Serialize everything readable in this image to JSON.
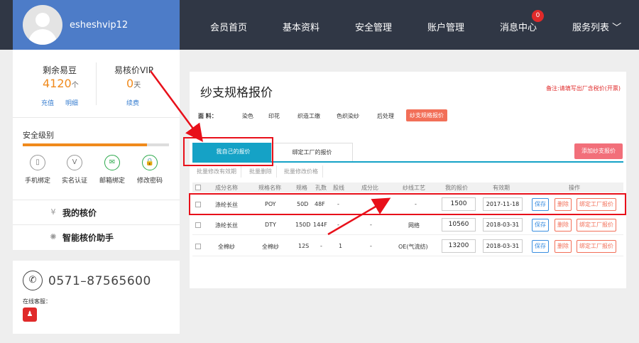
{
  "header": {
    "username": "esheshvip12",
    "nav": [
      "会员首页",
      "基本资料",
      "安全管理",
      "账户管理",
      "消息中心",
      "服务列表"
    ],
    "message_badge": "0",
    "service_caret": "﹀"
  },
  "account": {
    "beans_label": "剩余易豆",
    "beans_value": "4120",
    "beans_unit": "个",
    "recharge": "充值",
    "detail": "明细",
    "vip_label": "易核价VIP",
    "vip_value": "0",
    "vip_unit": "天",
    "renew": "续费"
  },
  "security": {
    "title": "安全级别",
    "level": 0.85,
    "items": [
      {
        "label": "手机绑定",
        "icon": "phone-icon",
        "glyph": "▯"
      },
      {
        "label": "实名认证",
        "icon": "verify-icon",
        "glyph": "V"
      },
      {
        "label": "邮箱绑定",
        "icon": "mail-icon",
        "glyph": "✉"
      },
      {
        "label": "修改密码",
        "icon": "lock-icon",
        "glyph": "🔒"
      }
    ]
  },
  "menu": [
    {
      "label": "我的核价",
      "icon": "price-icon",
      "glyph": "¥"
    },
    {
      "label": "智能核价助手",
      "icon": "bulb-icon",
      "glyph": "✺"
    }
  ],
  "contact": {
    "phone": "0571–87565600",
    "phone_glyph": "✆",
    "online_label": "在线客服：",
    "qq_glyph": "♟"
  },
  "main": {
    "title": "纱支规格报价",
    "note": "备注:请填写出厂含税价(开票)",
    "category_label": "面    料：",
    "categories": [
      "染色",
      "印花",
      "织造工缴",
      "色织染纱",
      "后处理",
      "纱支规格报价"
    ],
    "tabs": [
      "我自己的报价",
      "绑定工厂的报价"
    ],
    "add_button": "添加纱支报价",
    "batch": [
      "批量修改有效期",
      "批量删除",
      "批量修改价格"
    ],
    "columns": [
      "成分名称",
      "规格名称",
      "规格",
      "孔数",
      "股线",
      "成分比",
      "纱线工艺",
      "我的报价",
      "有效期",
      "操作"
    ],
    "rows": [
      {
        "component": "涤纶长丝",
        "spec_name": "POY",
        "spec": "50D",
        "holes": "48F",
        "ply": "-",
        "ratio": "",
        "process": "-",
        "price": "1500",
        "expiry": "2017-11-18"
      },
      {
        "component": "涤纶长丝",
        "spec_name": "DTY",
        "spec": "150D",
        "holes": "144F",
        "ply": "-",
        "ratio": "-",
        "process": "网络",
        "price": "10560",
        "expiry": "2018-03-31"
      },
      {
        "component": "全棉纱",
        "spec_name": "全棉纱",
        "spec": "12S",
        "holes": "-",
        "ply": "1",
        "ratio": "-",
        "process": "OE(气流纺)",
        "price": "13200",
        "expiry": "2018-03-31"
      }
    ],
    "actions": [
      "保存",
      "删除",
      "绑定工厂报价"
    ]
  },
  "colors": {
    "accent": "#15a2c6",
    "header_bg": "#303745",
    "user_bg": "#4d7cc8",
    "annotation": "#e8101a",
    "orange": "#f08a1c"
  }
}
